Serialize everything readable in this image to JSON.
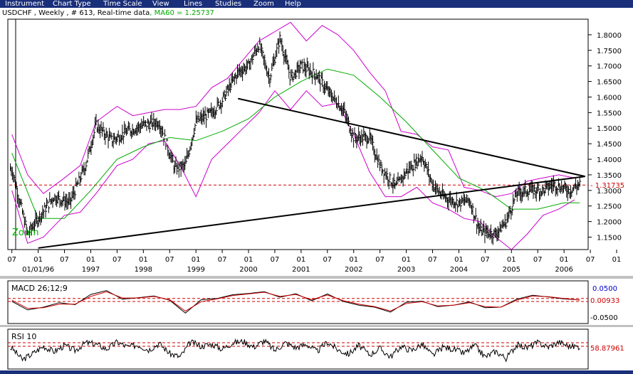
{
  "menu": {
    "items": [
      "Instrument",
      "Chart Type",
      "Time Scale",
      "View",
      "Lines",
      "Studies",
      "Zoom",
      "Help"
    ]
  },
  "header": {
    "prefix": "USDCHF , Weekly , # 613, Real-time data",
    "ma_label": ", MA60 = 1.25737"
  },
  "colors": {
    "price_bars": "#000000",
    "moving_average": "#00aa00",
    "envelope": "#cc00cc",
    "trend_lines": "#000000",
    "reference_lines": "#cc0000",
    "macd_level_label": "#0000cc",
    "zoom_label": "#00bb00"
  },
  "chart_data": [
    {
      "type": "line",
      "panel": "price",
      "instrument": "USDCHF",
      "timeframe": "Weekly",
      "x_tick_months": [
        "07",
        "01",
        "07",
        "01",
        "07",
        "01",
        "07",
        "01",
        "07",
        "01",
        "07",
        "01",
        "07",
        "01",
        "07",
        "01",
        "07",
        "01",
        "07",
        "01",
        "07",
        "01",
        "07",
        "01",
        "07",
        "01"
      ],
      "x_tick_years": [
        "01/01/96",
        "1997",
        "1998",
        "1999",
        "2000",
        "2001",
        "2002",
        "2003",
        "2004",
        "2005",
        "2006"
      ],
      "y_ticks": [
        "1.8000",
        "1.7500",
        "1.7000",
        "1.6500",
        "1.6000",
        "1.5500",
        "1.5000",
        "1.4500",
        "1.4000",
        "1.3500",
        "1.3000",
        "1.2500",
        "1.2000",
        "1.1500"
      ],
      "ylim": [
        1.11,
        1.85
      ],
      "last_price_label": "1.31735",
      "last_price": 1.31735,
      "zoom_label": "Zoom",
      "grid": false,
      "series": [
        {
          "name": "MA60",
          "last": 1.25737
        },
        {
          "key": "price_close",
          "x": [
            1995.5,
            1995.8,
            1996.0,
            1996.3,
            1996.6,
            1996.9,
            1997.1,
            1997.4,
            1997.7,
            1998.0,
            1998.3,
            1998.6,
            1998.8,
            1999.0,
            1999.3,
            1999.5,
            1999.8,
            2000.0,
            2000.2,
            2000.4,
            2000.6,
            2000.8,
            2001.0,
            2001.3,
            2001.5,
            2001.8,
            2002.0,
            2002.3,
            2002.5,
            2002.8,
            2003.0,
            2003.3,
            2003.5,
            2003.7,
            2004.0,
            2004.2,
            2004.4,
            2004.7,
            2004.9,
            2005.1,
            2005.3,
            2005.6,
            2005.8,
            2006.1,
            2006.3
          ],
          "y": [
            1.37,
            1.16,
            1.21,
            1.28,
            1.26,
            1.38,
            1.51,
            1.46,
            1.49,
            1.51,
            1.52,
            1.37,
            1.38,
            1.52,
            1.55,
            1.59,
            1.68,
            1.7,
            1.77,
            1.66,
            1.79,
            1.66,
            1.7,
            1.67,
            1.62,
            1.56,
            1.47,
            1.47,
            1.38,
            1.31,
            1.36,
            1.41,
            1.32,
            1.28,
            1.26,
            1.27,
            1.17,
            1.16,
            1.2,
            1.29,
            1.3,
            1.3,
            1.32,
            1.3,
            1.32
          ]
        },
        {
          "key": "ma60",
          "x": [
            1995.5,
            1996.0,
            1996.5,
            1997.0,
            1997.5,
            1998.0,
            1998.5,
            1999.0,
            1999.5,
            2000.0,
            2000.5,
            2001.0,
            2001.5,
            2002.0,
            2002.5,
            2003.0,
            2003.5,
            2004.0,
            2004.5,
            2005.0,
            2005.5,
            2006.0,
            2006.3
          ],
          "y": [
            1.42,
            1.21,
            1.21,
            1.3,
            1.4,
            1.44,
            1.47,
            1.46,
            1.49,
            1.53,
            1.6,
            1.65,
            1.69,
            1.67,
            1.6,
            1.52,
            1.43,
            1.34,
            1.3,
            1.24,
            1.24,
            1.26,
            1.26
          ]
        },
        {
          "key": "upper_envelope",
          "x": [
            1995.5,
            1995.8,
            1996.1,
            1996.5,
            1996.8,
            1997.1,
            1997.5,
            1997.8,
            1998.1,
            1998.4,
            1998.7,
            1999.0,
            1999.3,
            1999.6,
            1999.9,
            2000.2,
            2000.5,
            2000.8,
            2001.1,
            2001.4,
            2001.7,
            2002.0,
            2002.3,
            2002.6,
            2002.9,
            2003.2,
            2003.5,
            2003.8,
            2004.1,
            2004.4,
            2004.7,
            2005.0,
            2005.3,
            2005.6,
            2005.9,
            2006.2
          ],
          "y": [
            1.48,
            1.35,
            1.29,
            1.34,
            1.38,
            1.52,
            1.57,
            1.54,
            1.55,
            1.56,
            1.56,
            1.57,
            1.63,
            1.66,
            1.72,
            1.78,
            1.81,
            1.84,
            1.78,
            1.83,
            1.8,
            1.75,
            1.68,
            1.62,
            1.49,
            1.48,
            1.44,
            1.43,
            1.31,
            1.3,
            1.28,
            1.29,
            1.33,
            1.34,
            1.35,
            1.34
          ]
        },
        {
          "key": "lower_envelope",
          "x": [
            1995.5,
            1995.8,
            1996.1,
            1996.5,
            1996.8,
            1997.1,
            1997.5,
            1997.8,
            1998.1,
            1998.4,
            1998.7,
            1999.0,
            1999.3,
            1999.6,
            1999.9,
            2000.2,
            2000.5,
            2000.8,
            2001.1,
            2001.4,
            2001.7,
            2002.0,
            2002.3,
            2002.6,
            2002.9,
            2003.2,
            2003.5,
            2003.8,
            2004.1,
            2004.4,
            2004.7,
            2005.0,
            2005.3,
            2005.6,
            2005.9,
            2006.2
          ],
          "y": [
            1.3,
            1.13,
            1.15,
            1.22,
            1.23,
            1.29,
            1.38,
            1.4,
            1.45,
            1.46,
            1.38,
            1.28,
            1.4,
            1.45,
            1.5,
            1.55,
            1.62,
            1.56,
            1.62,
            1.57,
            1.58,
            1.48,
            1.36,
            1.28,
            1.28,
            1.31,
            1.26,
            1.24,
            1.21,
            1.2,
            1.15,
            1.11,
            1.16,
            1.22,
            1.24,
            1.27
          ]
        }
      ],
      "trend_lines": [
        {
          "name": "support",
          "x": [
            1996.0,
            2006.4
          ],
          "y": [
            1.115,
            1.345
          ]
        },
        {
          "name": "resistance",
          "x": [
            1999.8,
            2006.4
          ],
          "y": [
            1.595,
            1.345
          ]
        }
      ],
      "reference_line": 1.31735
    },
    {
      "type": "line",
      "panel": "indicator",
      "title": "MACD 26;12;9",
      "y_ticks": [
        "0.0500",
        "0.00933",
        "-0.0500"
      ],
      "ylim": [
        -0.08,
        0.08
      ],
      "reference_levels": [
        0.015,
        0.003
      ],
      "series": [
        {
          "key": "macd",
          "x": [
            1995.5,
            1995.8,
            1996.1,
            1996.4,
            1996.7,
            1997.0,
            1997.3,
            1997.6,
            1997.9,
            1998.2,
            1998.5,
            1998.8,
            1999.1,
            1999.4,
            1999.7,
            2000.0,
            2000.3,
            2000.6,
            2000.9,
            2001.2,
            2001.5,
            2001.8,
            2002.1,
            2002.4,
            2002.7,
            2003.0,
            2003.3,
            2003.6,
            2003.9,
            2004.2,
            2004.5,
            2004.8,
            2005.1,
            2005.4,
            2005.7,
            2006.0,
            2006.3
          ],
          "y": [
            0.003,
            -0.031,
            -0.02,
            -0.002,
            -0.01,
            0.031,
            0.047,
            0.012,
            0.018,
            0.025,
            0.008,
            -0.044,
            0.01,
            0.015,
            0.03,
            0.035,
            0.042,
            0.02,
            0.034,
            0.006,
            0.033,
            0.003,
            -0.012,
            -0.02,
            -0.04,
            0.0,
            0.004,
            -0.018,
            -0.012,
            0.001,
            -0.022,
            -0.02,
            0.012,
            0.028,
            0.021,
            0.013,
            0.009
          ]
        },
        {
          "key": "signal",
          "x": [
            1995.5,
            1995.8,
            1996.1,
            1996.4,
            1996.7,
            1997.0,
            1997.3,
            1997.6,
            1997.9,
            1998.2,
            1998.5,
            1998.8,
            1999.1,
            1999.4,
            1999.7,
            2000.0,
            2000.3,
            2000.6,
            2000.9,
            2001.2,
            2001.5,
            2001.8,
            2002.1,
            2002.4,
            2002.7,
            2003.0,
            2003.3,
            2003.6,
            2003.9,
            2004.2,
            2004.5,
            2004.8,
            2005.1,
            2005.4,
            2005.7,
            2006.0,
            2006.3
          ],
          "y": [
            0.008,
            -0.025,
            -0.022,
            -0.008,
            -0.008,
            0.023,
            0.042,
            0.017,
            0.017,
            0.023,
            0.01,
            -0.036,
            0.002,
            0.013,
            0.027,
            0.033,
            0.04,
            0.023,
            0.031,
            0.01,
            0.029,
            0.006,
            -0.008,
            -0.018,
            -0.035,
            -0.005,
            0.002,
            -0.015,
            -0.012,
            -0.002,
            -0.018,
            -0.02,
            0.008,
            0.025,
            0.022,
            0.015,
            0.009
          ]
        }
      ],
      "last_value_label": "0.00933",
      "upper_label": "0.0500",
      "lower_label": "-0.0500"
    },
    {
      "type": "line",
      "panel": "indicator",
      "title": "RSI 10",
      "ylim": [
        0,
        100
      ],
      "reference_levels": [
        70,
        60
      ],
      "last_value_label": "58.87961",
      "series": [
        {
          "key": "rsi",
          "x": [
            1995.5,
            1995.7,
            1995.9,
            1996.1,
            1996.3,
            1996.5,
            1996.7,
            1996.9,
            1997.1,
            1997.3,
            1997.5,
            1997.7,
            1997.9,
            1998.1,
            1998.3,
            1998.5,
            1998.7,
            1998.9,
            1999.1,
            1999.3,
            1999.5,
            1999.7,
            1999.9,
            2000.1,
            2000.3,
            2000.5,
            2000.7,
            2000.9,
            2001.1,
            2001.3,
            2001.5,
            2001.7,
            2001.9,
            2002.1,
            2002.3,
            2002.5,
            2002.7,
            2002.9,
            2003.1,
            2003.3,
            2003.5,
            2003.7,
            2003.9,
            2004.1,
            2004.3,
            2004.5,
            2004.7,
            2004.9,
            2005.1,
            2005.3,
            2005.5,
            2005.7,
            2005.9,
            2006.1,
            2006.3
          ],
          "y": [
            55,
            22,
            40,
            60,
            45,
            62,
            48,
            70,
            66,
            52,
            72,
            58,
            64,
            50,
            68,
            40,
            30,
            72,
            60,
            66,
            52,
            70,
            74,
            58,
            76,
            48,
            70,
            56,
            66,
            45,
            72,
            50,
            38,
            62,
            36,
            54,
            30,
            60,
            48,
            66,
            34,
            58,
            52,
            40,
            62,
            30,
            46,
            26,
            64,
            56,
            70,
            58,
            72,
            60,
            59
          ]
        }
      ]
    }
  ]
}
